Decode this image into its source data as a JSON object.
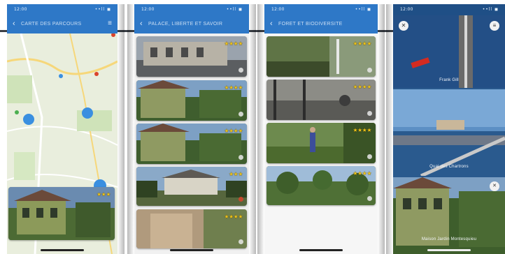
{
  "status_bar": {
    "time": "12:00",
    "signal": "••ll ◼"
  },
  "screens": [
    {
      "title": "Carte des parcours",
      "back": "‹",
      "menu": "≡"
    },
    {
      "title": "Palace, Liberté et Savoir",
      "back": "‹"
    },
    {
      "title": "Forêt et Biodiversité",
      "back": "‹"
    },
    {
      "close": "✕",
      "menu": "≡",
      "panels": [
        "Frank Gill",
        "Quai des Chartrons",
        "Maison Jardin Montesquieu"
      ]
    }
  ],
  "map": {
    "cluster_color": "#3a8fe0"
  },
  "colors": {
    "accent": "#2e78c7",
    "star": "#f0c419",
    "favorite": "#d9442c"
  },
  "icons": {
    "back": "chevron-left-icon",
    "menu": "hamburger-icon",
    "close": "close-icon",
    "star": "star-icon",
    "favorite": "heart-icon"
  },
  "cards": {
    "screen1": [
      {
        "stars": "★★★"
      }
    ],
    "screen2": [
      {
        "stars": "★★★★",
        "caption": ""
      },
      {
        "stars": "★★★★",
        "caption": ""
      },
      {
        "stars": "★★★★",
        "caption": ""
      },
      {
        "stars": "★★★",
        "caption": ""
      },
      {
        "stars": "★★★★",
        "caption": ""
      }
    ],
    "screen3": [
      {
        "stars": "★★★★",
        "caption": ""
      },
      {
        "stars": "★★★★",
        "caption": ""
      },
      {
        "stars": "★★★★",
        "caption": ""
      },
      {
        "stars": "★★★★",
        "caption": ""
      }
    ]
  }
}
